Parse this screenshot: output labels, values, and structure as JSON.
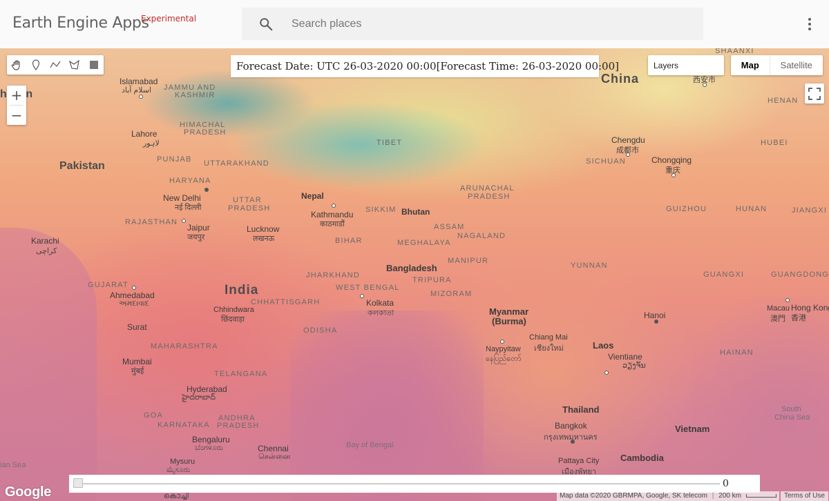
{
  "app": {
    "title": "Earth Engine Apps",
    "tag": "Experimental"
  },
  "search": {
    "placeholder": "Search places"
  },
  "map": {
    "forecast_text": "Forecast Date: UTC 26-03-2020 00:00[Forecast Time: 26-03-2020 00:00]",
    "layers_label": "Layers",
    "map_types": {
      "map": "Map",
      "satellite": "Satellite"
    },
    "zoom": {
      "in": "+",
      "out": "−"
    },
    "slider_value": "0",
    "google_logo": "Google",
    "attribution": "Map data ©2020 GBRMPA, Google, SK telecom",
    "scale_label": "200 km",
    "terms": "Terms of Use",
    "labels": {
      "china": "China",
      "pakistan": "Pakistan",
      "pakistan_partial": "histan",
      "india": "India",
      "nepal": "Nepal",
      "bhutan": "Bhutan",
      "bangladesh": "Bangladesh",
      "myanmar": "Myanmar",
      "burma": "(Burma)",
      "laos": "Laos",
      "thailand": "Thailand",
      "vietnam": "Vietnam",
      "cambodia": "Cambodia",
      "tibet": "TIBET",
      "sichuan": "SICHUAN",
      "henan": "HENAN",
      "hubei": "HUBEI",
      "shaanxi": "SHAANXI",
      "guizhou": "GUIZHOU",
      "hunan": "HUNAN",
      "jiangxi": "JIANGXI",
      "yunnan": "YUNNAN",
      "guangxi": "GUANGXI",
      "guangdong": "GUANGDONG",
      "hainan": "HAINAN",
      "jammu": "JAMMU AND",
      "kashmir": "KASHMIR",
      "himachal": "HIMACHAL",
      "pradesh_hp": "PRADESH",
      "punjab": "PUNJAB",
      "uttarakhand": "UTTARAKHAND",
      "haryana": "HARYANA",
      "uttar": "UTTAR",
      "pradesh_up": "PRADESH",
      "rajasthan": "RAJASTHAN",
      "bihar": "BIHAR",
      "sikkim": "SIKKIM",
      "assam": "ASSAM",
      "nagaland": "NAGALAND",
      "meghalaya": "MEGHALAYA",
      "arunachal": "ARUNACHAL",
      "pradesh_ap": "PRADESH",
      "manipur": "MANIPUR",
      "tripura": "TRIPURA",
      "mizoram": "MIZORAM",
      "jharkhand": "JHARKHAND",
      "west_bengal": "WEST BENGAL",
      "gujarat": "GUJARAT",
      "chhattisgarh": "CHHATTISGARH",
      "odisha": "ODISHA",
      "maharashtra": "MAHARASHTRA",
      "telangana": "TELANGANA",
      "andhra": "ANDHRA",
      "pradesh_andhra": "PRADESH",
      "goa": "GOA",
      "karnataka": "KARNATAKA",
      "islamabad": "Islamabad",
      "islamabad_native": "اسلام آباد",
      "lahore": "Lahore",
      "lahore_native": "لاہور",
      "new_delhi": "New Delhi",
      "new_delhi_native": "नई दिल्ली",
      "jaipur": "Jaipur",
      "jaipur_native": "जयपुर",
      "lucknow": "Lucknow",
      "lucknow_native": "लखनऊ",
      "karachi": "Karachi",
      "karachi_native": "کراچی",
      "kathmandu": "Kathmandu",
      "kathmandu_native": "काठमाडौं",
      "ahmedabad": "Ahmedabad",
      "ahmedabad_native": "અમદાવાદ",
      "kolkata": "Kolkata",
      "kolkata_native": "কলকাতা",
      "chhindwara": "Chhindwara",
      "chhindwara_native": "छिंदवाड़ा",
      "surat": "Surat",
      "mumbai": "Mumbai",
      "mumbai_native": "मुंबई",
      "hyderabad": "Hyderabad",
      "hyderabad_native": "హైదరాబాద్",
      "bengaluru": "Bengaluru",
      "bengaluru_native": "ಬೆಂಗಳೂರು",
      "chennai": "Chennai",
      "chennai_native": "சென்னை",
      "mysuru": "Mysuru",
      "mysuru_native": "ಮೈಸೂರು",
      "kochi_native": "കൊച്ചി",
      "chengdu": "Chengdu",
      "chengdu_native": "成都市",
      "chongqing": "Chongqing",
      "chongqing_native": "重庆",
      "xian_native": "西安市",
      "naypyitaw": "Naypyitaw",
      "naypyitaw_native": "နေပြည်တော်",
      "chiang_mai": "Chiang Mai",
      "chiang_mai_native": "เชียงใหม่",
      "hanoi": "Hanoi",
      "vientiane": "Vientiane",
      "vientiane_native": "ວຽງຈັນ",
      "bangkok": "Bangkok",
      "bangkok_native": "กรุงเทพมหานคร",
      "pattaya": "Pattaya City",
      "pattaya_native": "เมืองพัทยา",
      "macau": "Macau",
      "macau_native": "澳門",
      "hong_kong": "Hong Kong",
      "hong_kong_native": "香港",
      "bay_of_bengal": "Bay of Bengal",
      "south_china_sea_1": "South",
      "south_china_sea_2": "China Sea",
      "arabian_sea": "ian Sea"
    }
  }
}
